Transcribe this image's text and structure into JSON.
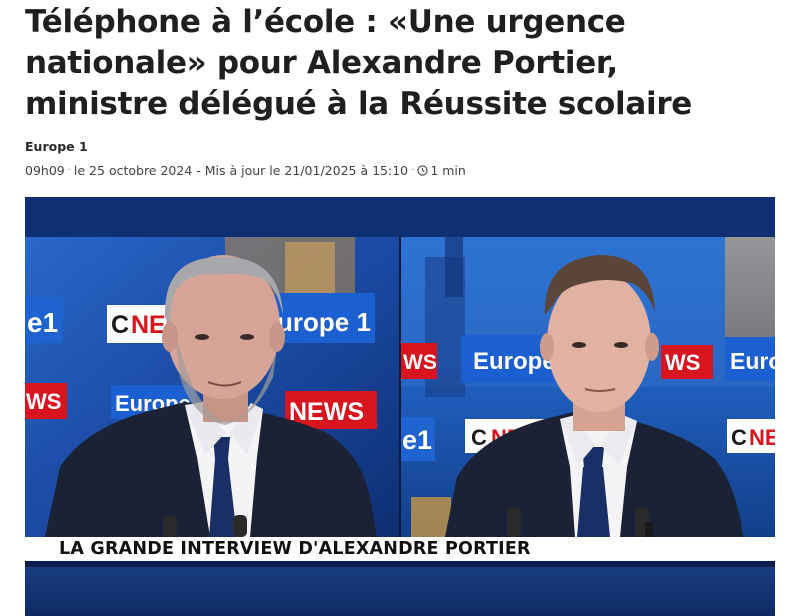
{
  "article": {
    "title": "Téléphone à l’école : «Une urgence nationale» pour Alexandre Portier, ministre délégué à la Réussite scolaire",
    "source": "Europe 1",
    "time": "09h09",
    "date": "le 25 octobre 2024",
    "updated": "- Mis à jour le 21/01/2025 à 15:10",
    "reading_time": "1 min"
  },
  "media": {
    "banner_text": "LA GRANDE INTERVIEW D'ALEXANDRE PORTIER",
    "set_logos": {
      "cnews_c": "C",
      "cnews_n": "NE",
      "news": "NEWS",
      "europe": "Europe",
      "europe_one": "urope 1",
      "ws": "WS",
      "e1": "e1",
      "ne": "NE"
    },
    "colors": {
      "cnews_red": "#d8141e",
      "set_blue": "#1b4fae",
      "suit": "#1b2236",
      "tie": "#1a2f66"
    }
  }
}
